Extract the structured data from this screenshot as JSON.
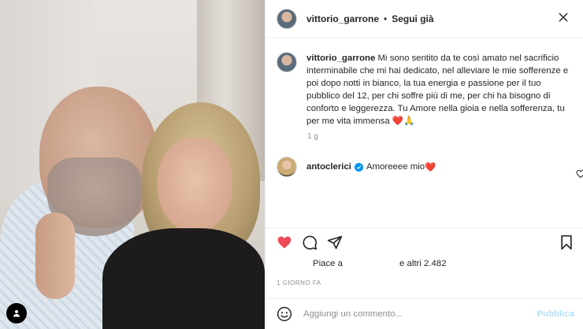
{
  "post": {
    "author": "vittorio_garrone",
    "dot": "•",
    "follow_label": "Segui già",
    "caption_user": "vittorio_garrone",
    "caption_text": "Mi sono sentito da te così amato nel sacrificio interminabile che mi hai dedicato, nel alleviare le mie sofferenze e poi dopo notti in bianco, la tua energia e passione per il tuo pubblico del 12, per chi soffre più di me, per chi ha bisogno di conforto e leggerezza. Tu Amore nella gioia e nella sofferenza, tu per me vita immensa",
    "caption_emoji": "❤️🙏",
    "caption_time": "1 g"
  },
  "reply": {
    "user": "antoclerici",
    "text": "Amoreeee mio",
    "emoji": "❤️"
  },
  "likes": {
    "prefix": "Piace a",
    "suffix": "e altri 2.482"
  },
  "posted_ago": "1 GIORNO FA",
  "comment_box": {
    "placeholder": "Aggiungi un commento...",
    "publish_label": "Pubblica"
  },
  "icons": {
    "like": "heart-filled-icon",
    "comment": "comment-icon",
    "share": "share-icon",
    "save": "bookmark-icon",
    "more": "more-icon",
    "close": "close-icon",
    "emoji": "emoji-icon",
    "tag": "user-tag-icon"
  },
  "colors": {
    "like_red": "#ed4956",
    "verified_blue": "#0095f6",
    "publish_disabled": "#b2dffc",
    "muted": "#8e8e8e"
  }
}
